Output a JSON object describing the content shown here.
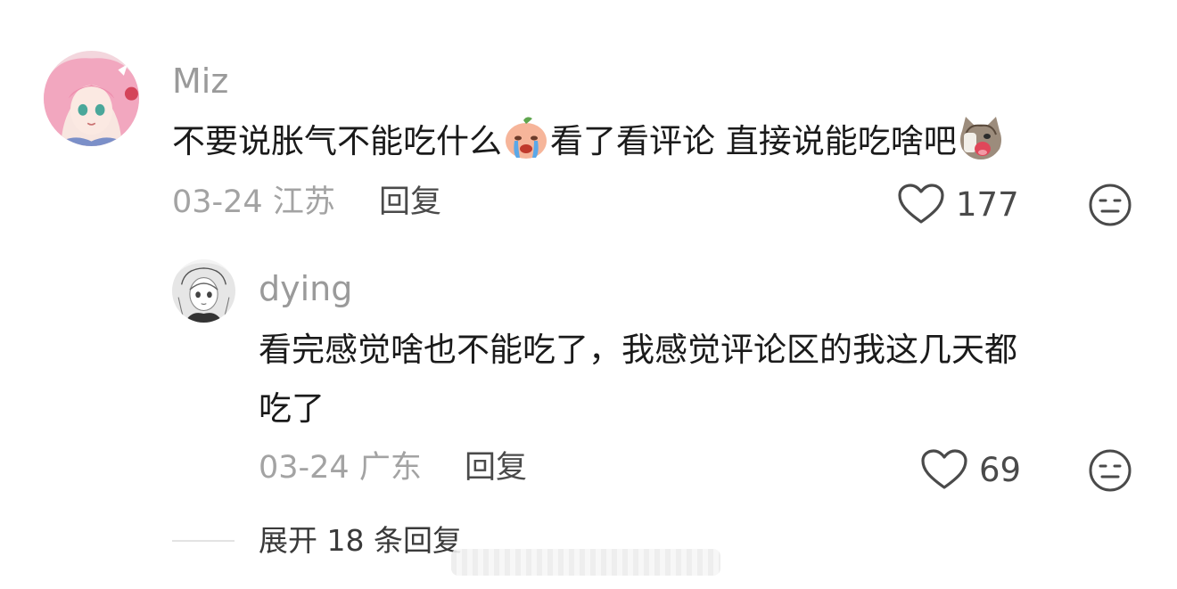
{
  "comments": [
    {
      "username": "Miz",
      "avatar_icon": "anime-girl-avatar",
      "text_parts": [
        "不要说胀气不能吃什么",
        "看了看评论 直接说能吃啥吧"
      ],
      "emojis": [
        "crying-peach-emoji",
        "screaming-cat-emoji"
      ],
      "date_location": "03-24 江苏",
      "reply_label": "回复",
      "like_count": "177"
    }
  ],
  "replies": [
    {
      "username": "dying",
      "avatar_icon": "sketch-girl-avatar",
      "text_line1": "看完感觉啥也不能吃了，我感觉评论区的我这几天都",
      "text_line2": "吃了",
      "date_location": "03-24 广东",
      "reply_label": "回复",
      "like_count": "69"
    }
  ],
  "expand": {
    "label": "展开 18 条回复"
  },
  "colors": {
    "username": "#9a9a9a",
    "body_text": "#1a1a1a",
    "meta": "#a3a3a3",
    "action": "#4a4a4a"
  }
}
